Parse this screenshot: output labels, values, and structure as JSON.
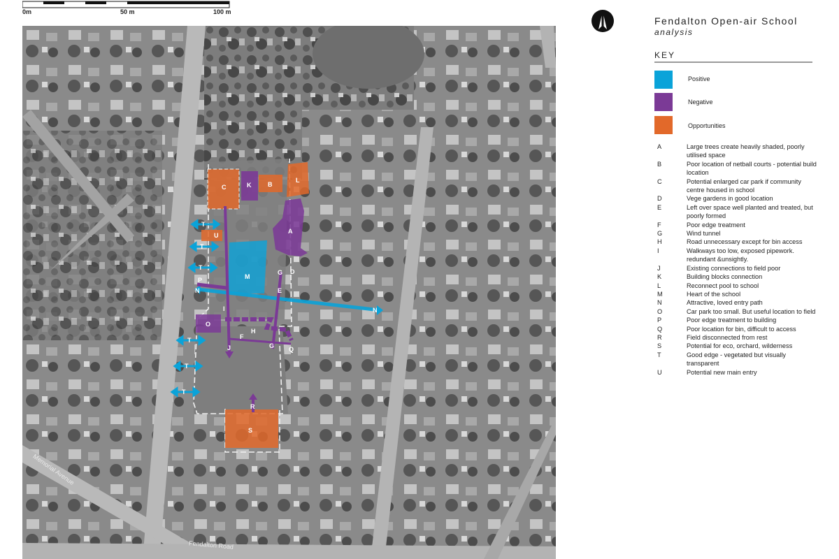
{
  "title": "Fendalton Open-air School",
  "subtitle": "analysis",
  "scale": {
    "labels": [
      "0m",
      "50 m",
      "100 m"
    ]
  },
  "key": {
    "heading": "KEY",
    "categories": [
      {
        "label": "Positive",
        "color": "#0aa3d9"
      },
      {
        "label": "Negative",
        "color": "#7b3a96"
      },
      {
        "label": "Opportunities",
        "color": "#e2692a"
      }
    ],
    "items": [
      {
        "letter": "A",
        "text": "Large trees create heavily shaded, poorly utilised space"
      },
      {
        "letter": "B",
        "text": "Poor location of netball courts - potential build location"
      },
      {
        "letter": "C",
        "text": "Potential enlarged car park if community centre housed in school"
      },
      {
        "letter": "D",
        "text": "Vege gardens in good location"
      },
      {
        "letter": "E",
        "text": "Left over space well planted and treated, but poorly formed"
      },
      {
        "letter": "F",
        "text": "Poor edge treatment"
      },
      {
        "letter": "G",
        "text": "Wind tunnel"
      },
      {
        "letter": "H",
        "text": "Road unnecessary except for bin access"
      },
      {
        "letter": "I",
        "text": "Walkways too low, exposed pipework. redundant &unsightly."
      },
      {
        "letter": "J",
        "text": "Existing connections to field poor"
      },
      {
        "letter": "K",
        "text": "Building blocks connection"
      },
      {
        "letter": "L",
        "text": "Reconnect pool to school"
      },
      {
        "letter": "M",
        "text": "Heart of the school"
      },
      {
        "letter": "N",
        "text": "Attractive, loved entry path"
      },
      {
        "letter": "O",
        "text": "Car park too small. But useful location to field"
      },
      {
        "letter": "P",
        "text": "Poor edge treatment to building"
      },
      {
        "letter": "Q",
        "text": "Poor location for bin, difficult to access"
      },
      {
        "letter": "R",
        "text": "Field disconnected from rest"
      },
      {
        "letter": "S",
        "text": "Potential for eco, orchard, wilderness"
      },
      {
        "letter": "T",
        "text": "Good edge - vegetated but visually transparent"
      },
      {
        "letter": "U",
        "text": "Potential new main entry"
      }
    ]
  },
  "map": {
    "streets": [
      "Memorial Avenue",
      "Fendalton Road"
    ],
    "markers": {
      "A": "A",
      "B": "B",
      "C": "C",
      "D": "D",
      "E": "E",
      "F": "F",
      "G1": "G",
      "G2": "G",
      "H": "H",
      "I": "I",
      "J": "J",
      "K": "K",
      "L": "L",
      "M": "M",
      "N1": "N",
      "N2": "N",
      "O": "O",
      "P": "P",
      "Q": "Q",
      "R": "R",
      "S": "S",
      "U": "U",
      "T1": "T",
      "T2": "T",
      "T3": "T",
      "T4": "T",
      "T5": "T",
      "T6": "T"
    }
  }
}
